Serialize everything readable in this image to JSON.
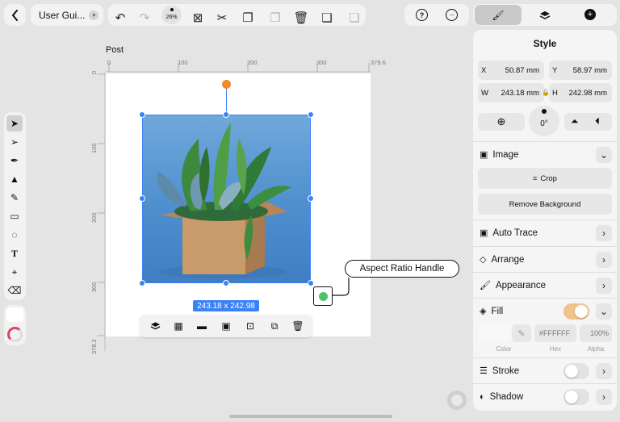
{
  "top_bar": {
    "back_icon": "chevron-left-icon",
    "doc_title": "User Gui...",
    "zoom_label": "26%"
  },
  "canvas": {
    "document_name": "Post",
    "ruler_h": [
      "0",
      "100",
      "200",
      "300",
      "379.6"
    ],
    "ruler_v": [
      "0",
      "100",
      "200",
      "300",
      "378.2"
    ],
    "size_badge": "243.18 x 242.98",
    "callout": "Aspect Ratio Handle"
  },
  "panel": {
    "title": "Style",
    "x_label": "X",
    "x_value": "50.87 mm",
    "y_label": "Y",
    "y_value": "58.97 mm",
    "w_label": "W",
    "w_value": "243.18 mm",
    "h_label": "H",
    "h_value": "242.98 mm",
    "rotation": "0°",
    "section_image": "Image",
    "crop": "Crop",
    "remove_bg": "Remove Background",
    "auto_trace": "Auto Trace",
    "arrange": "Arrange",
    "appearance": "Appearance",
    "fill": "Fill",
    "fill_on": true,
    "hex_placeholder": "#FFFFFF",
    "alpha_placeholder": "100%",
    "color_label": "Color",
    "hex_label": "Hex",
    "alpha_label": "Alpha",
    "stroke": "Stroke",
    "stroke_on": false,
    "shadow": "Shadow",
    "shadow_on": false
  },
  "colors": {
    "accent_blue": "#3b82f6",
    "toggle_on": "#f0c48e",
    "rotation_handle": "#f08a2c",
    "aspect_handle": "#4cc26a"
  }
}
